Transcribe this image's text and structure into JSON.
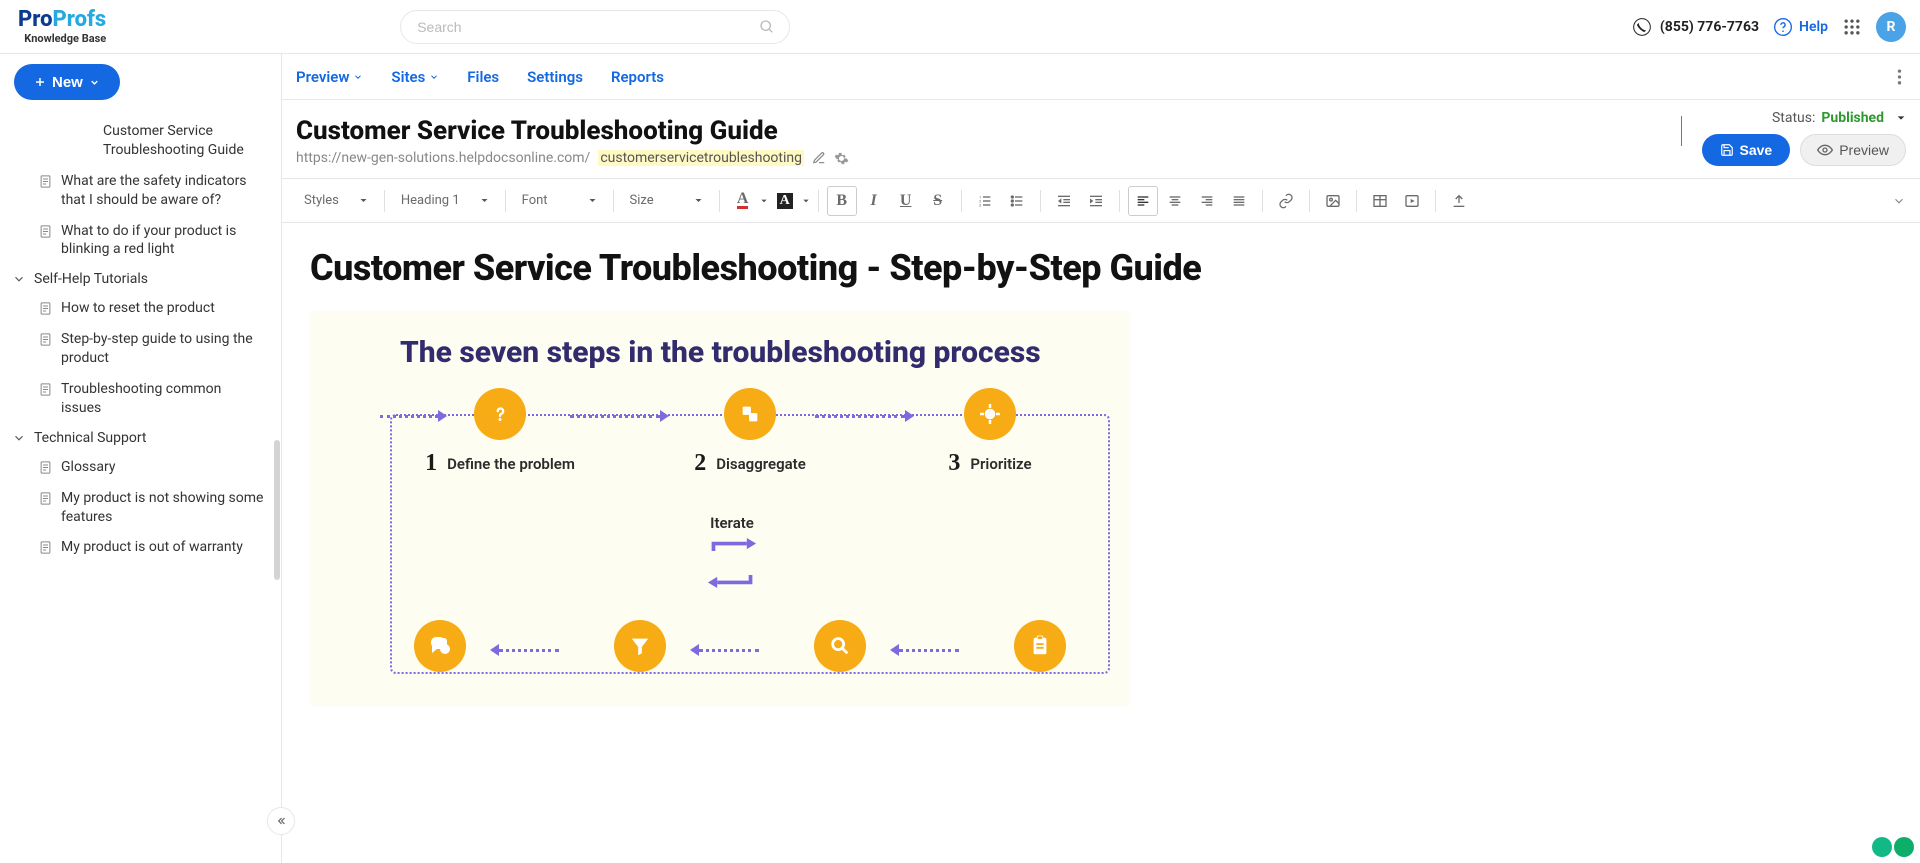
{
  "header": {
    "logo_pro": "Pro",
    "logo_profs": "Profs",
    "logo_sub": "Knowledge Base",
    "search_placeholder": "Search",
    "phone": "(855) 776-7763",
    "help": "Help",
    "avatar_initial": "R"
  },
  "sidebar": {
    "new_btn": "New",
    "items": [
      {
        "type": "page",
        "label": "Customer Service Troubleshooting Guide",
        "indent": true,
        "noicon": true,
        "active": false
      },
      {
        "type": "page",
        "label": "What are the safety indicators that I should be aware of?",
        "indent": true
      },
      {
        "type": "page",
        "label": "What to do if your product is blinking a red light",
        "indent": true
      },
      {
        "type": "folder",
        "label": "Self-Help Tutorials"
      },
      {
        "type": "page",
        "label": "How to reset the product",
        "indent": true
      },
      {
        "type": "page",
        "label": "Step-by-step guide to using the product",
        "indent": true
      },
      {
        "type": "page",
        "label": "Troubleshooting common issues",
        "indent": true
      },
      {
        "type": "folder",
        "label": "Technical Support"
      },
      {
        "type": "page",
        "label": "Glossary",
        "indent": true
      },
      {
        "type": "page",
        "label": "My product is not showing some features",
        "indent": true
      },
      {
        "type": "page",
        "label": "My product is out of warranty",
        "indent": true
      }
    ]
  },
  "main_nav": [
    "Preview",
    "Sites",
    "Files",
    "Settings",
    "Reports"
  ],
  "page": {
    "title": "Customer Service Troubleshooting Guide",
    "url_base": "https://new-gen-solutions.helpdocsonline.com/",
    "url_slug": "customerservicetroubleshooting",
    "status_label": "Status:",
    "status_value": "Published",
    "save": "Save",
    "preview": "Preview"
  },
  "toolbar": {
    "styles": "Styles",
    "heading": "Heading 1",
    "font": "Font",
    "size": "Size"
  },
  "content": {
    "h1": "Customer Service Troubleshooting - Step-by-Step Guide",
    "diagram_title": "The seven steps in the troubleshooting process",
    "steps_top": [
      {
        "num": "1",
        "label": "Define the problem"
      },
      {
        "num": "2",
        "label": "Disaggregate"
      },
      {
        "num": "3",
        "label": "Prioritize"
      }
    ],
    "iterate": "Iterate"
  }
}
